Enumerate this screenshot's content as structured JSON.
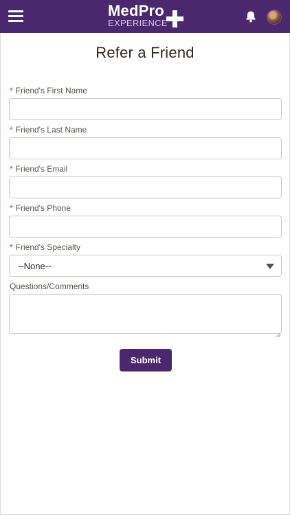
{
  "header": {
    "logo_main": "MedPro",
    "logo_sub": "EXPERIENCE",
    "menu_icon": "hamburger-menu-icon",
    "notification_icon": "bell-icon",
    "avatar_icon": "user-avatar"
  },
  "page": {
    "title": "Refer a Friend"
  },
  "form": {
    "required_marker": "*",
    "fields": [
      {
        "label": "Friend's First Name",
        "required": true,
        "value": "",
        "placeholder": ""
      },
      {
        "label": "Friend's Last Name",
        "required": true,
        "value": "",
        "placeholder": ""
      },
      {
        "label": "Friend's Email",
        "required": true,
        "value": "",
        "placeholder": ""
      },
      {
        "label": "Friend's Phone",
        "required": true,
        "value": "",
        "placeholder": ""
      }
    ],
    "specialty": {
      "label": "Friend's Specialty",
      "required": true,
      "selected": "--None--"
    },
    "comments": {
      "label": "Questions/Comments",
      "required": false,
      "value": ""
    },
    "submit_label": "Submit"
  },
  "colors": {
    "brand_purple": "#4b286d",
    "required_red": "#c23934"
  }
}
